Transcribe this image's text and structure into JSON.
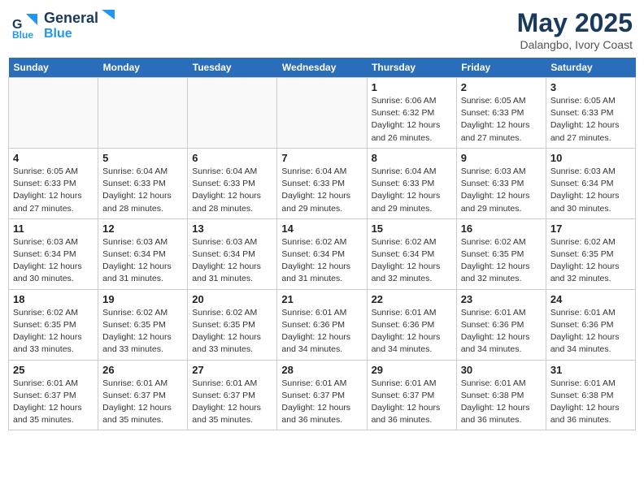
{
  "header": {
    "logo_line1": "General",
    "logo_line2": "Blue",
    "month_year": "May 2025",
    "location": "Dalangbo, Ivory Coast"
  },
  "days_of_week": [
    "Sunday",
    "Monday",
    "Tuesday",
    "Wednesday",
    "Thursday",
    "Friday",
    "Saturday"
  ],
  "weeks": [
    [
      {
        "day": "",
        "info": ""
      },
      {
        "day": "",
        "info": ""
      },
      {
        "day": "",
        "info": ""
      },
      {
        "day": "",
        "info": ""
      },
      {
        "day": "1",
        "info": "Sunrise: 6:06 AM\nSunset: 6:32 PM\nDaylight: 12 hours\nand 26 minutes."
      },
      {
        "day": "2",
        "info": "Sunrise: 6:05 AM\nSunset: 6:33 PM\nDaylight: 12 hours\nand 27 minutes."
      },
      {
        "day": "3",
        "info": "Sunrise: 6:05 AM\nSunset: 6:33 PM\nDaylight: 12 hours\nand 27 minutes."
      }
    ],
    [
      {
        "day": "4",
        "info": "Sunrise: 6:05 AM\nSunset: 6:33 PM\nDaylight: 12 hours\nand 27 minutes."
      },
      {
        "day": "5",
        "info": "Sunrise: 6:04 AM\nSunset: 6:33 PM\nDaylight: 12 hours\nand 28 minutes."
      },
      {
        "day": "6",
        "info": "Sunrise: 6:04 AM\nSunset: 6:33 PM\nDaylight: 12 hours\nand 28 minutes."
      },
      {
        "day": "7",
        "info": "Sunrise: 6:04 AM\nSunset: 6:33 PM\nDaylight: 12 hours\nand 29 minutes."
      },
      {
        "day": "8",
        "info": "Sunrise: 6:04 AM\nSunset: 6:33 PM\nDaylight: 12 hours\nand 29 minutes."
      },
      {
        "day": "9",
        "info": "Sunrise: 6:03 AM\nSunset: 6:33 PM\nDaylight: 12 hours\nand 29 minutes."
      },
      {
        "day": "10",
        "info": "Sunrise: 6:03 AM\nSunset: 6:34 PM\nDaylight: 12 hours\nand 30 minutes."
      }
    ],
    [
      {
        "day": "11",
        "info": "Sunrise: 6:03 AM\nSunset: 6:34 PM\nDaylight: 12 hours\nand 30 minutes."
      },
      {
        "day": "12",
        "info": "Sunrise: 6:03 AM\nSunset: 6:34 PM\nDaylight: 12 hours\nand 31 minutes."
      },
      {
        "day": "13",
        "info": "Sunrise: 6:03 AM\nSunset: 6:34 PM\nDaylight: 12 hours\nand 31 minutes."
      },
      {
        "day": "14",
        "info": "Sunrise: 6:02 AM\nSunset: 6:34 PM\nDaylight: 12 hours\nand 31 minutes."
      },
      {
        "day": "15",
        "info": "Sunrise: 6:02 AM\nSunset: 6:34 PM\nDaylight: 12 hours\nand 32 minutes."
      },
      {
        "day": "16",
        "info": "Sunrise: 6:02 AM\nSunset: 6:35 PM\nDaylight: 12 hours\nand 32 minutes."
      },
      {
        "day": "17",
        "info": "Sunrise: 6:02 AM\nSunset: 6:35 PM\nDaylight: 12 hours\nand 32 minutes."
      }
    ],
    [
      {
        "day": "18",
        "info": "Sunrise: 6:02 AM\nSunset: 6:35 PM\nDaylight: 12 hours\nand 33 minutes."
      },
      {
        "day": "19",
        "info": "Sunrise: 6:02 AM\nSunset: 6:35 PM\nDaylight: 12 hours\nand 33 minutes."
      },
      {
        "day": "20",
        "info": "Sunrise: 6:02 AM\nSunset: 6:35 PM\nDaylight: 12 hours\nand 33 minutes."
      },
      {
        "day": "21",
        "info": "Sunrise: 6:01 AM\nSunset: 6:36 PM\nDaylight: 12 hours\nand 34 minutes."
      },
      {
        "day": "22",
        "info": "Sunrise: 6:01 AM\nSunset: 6:36 PM\nDaylight: 12 hours\nand 34 minutes."
      },
      {
        "day": "23",
        "info": "Sunrise: 6:01 AM\nSunset: 6:36 PM\nDaylight: 12 hours\nand 34 minutes."
      },
      {
        "day": "24",
        "info": "Sunrise: 6:01 AM\nSunset: 6:36 PM\nDaylight: 12 hours\nand 34 minutes."
      }
    ],
    [
      {
        "day": "25",
        "info": "Sunrise: 6:01 AM\nSunset: 6:37 PM\nDaylight: 12 hours\nand 35 minutes."
      },
      {
        "day": "26",
        "info": "Sunrise: 6:01 AM\nSunset: 6:37 PM\nDaylight: 12 hours\nand 35 minutes."
      },
      {
        "day": "27",
        "info": "Sunrise: 6:01 AM\nSunset: 6:37 PM\nDaylight: 12 hours\nand 35 minutes."
      },
      {
        "day": "28",
        "info": "Sunrise: 6:01 AM\nSunset: 6:37 PM\nDaylight: 12 hours\nand 36 minutes."
      },
      {
        "day": "29",
        "info": "Sunrise: 6:01 AM\nSunset: 6:37 PM\nDaylight: 12 hours\nand 36 minutes."
      },
      {
        "day": "30",
        "info": "Sunrise: 6:01 AM\nSunset: 6:38 PM\nDaylight: 12 hours\nand 36 minutes."
      },
      {
        "day": "31",
        "info": "Sunrise: 6:01 AM\nSunset: 6:38 PM\nDaylight: 12 hours\nand 36 minutes."
      }
    ]
  ]
}
